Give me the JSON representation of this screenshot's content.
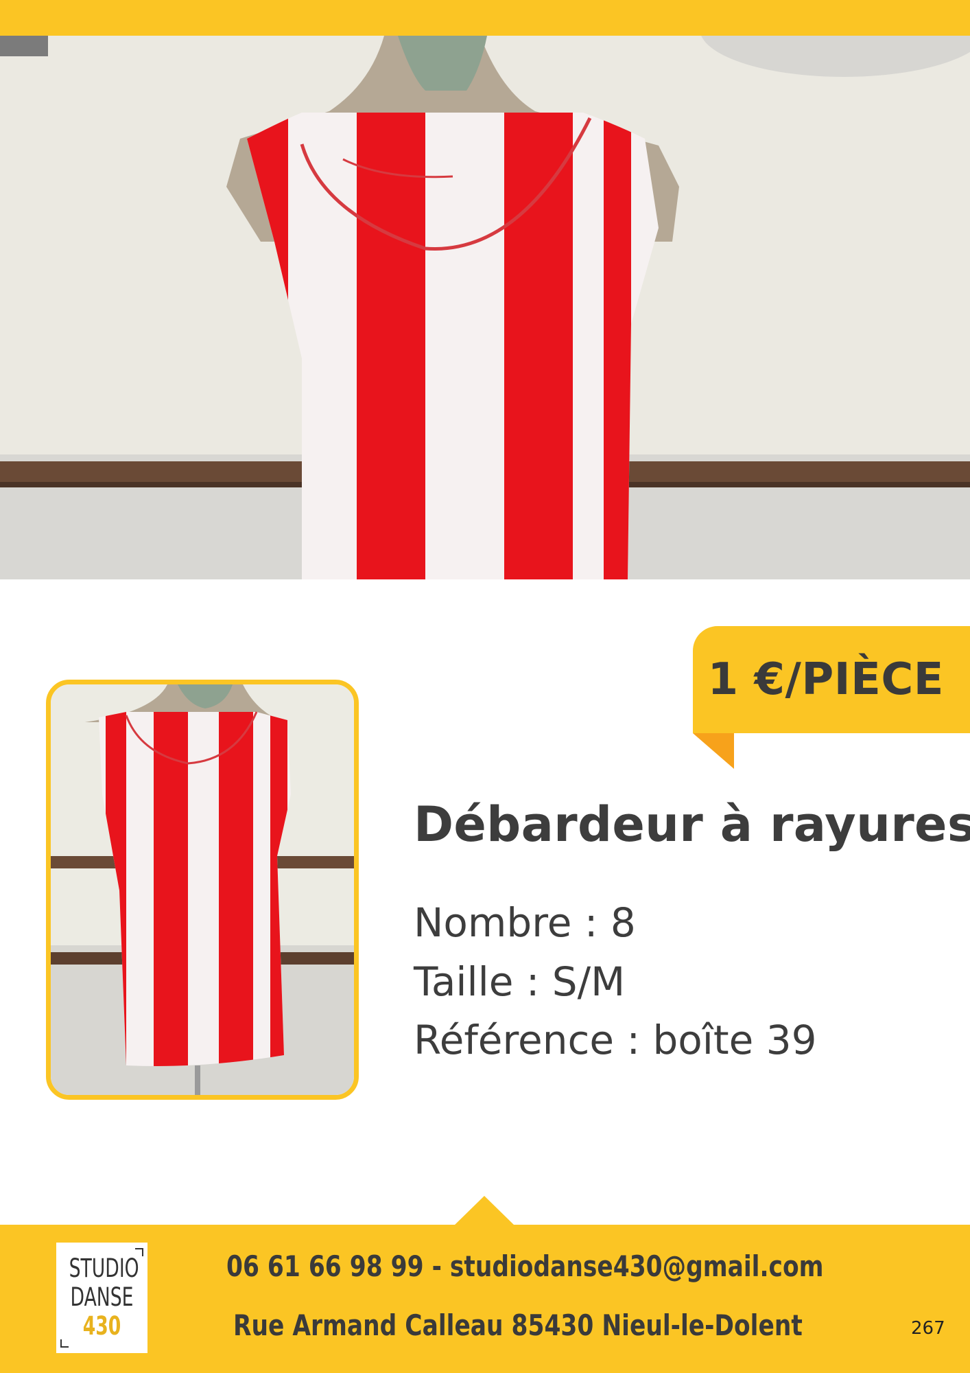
{
  "price": {
    "label": "1 €/PIÈCE"
  },
  "product": {
    "title": "Débardeur à rayures",
    "details": [
      "Nombre : 8",
      "Taille : S/M",
      "Référence : boîte 39"
    ]
  },
  "footer": {
    "logo_lines": [
      "STUDIO",
      "DANSE",
      "430"
    ],
    "contact": "06 61 66 98 99 - studiodanse430@gmail.com",
    "address": "Rue Armand Calleau 85430 Nieul-le-Dolent",
    "page_number": "267"
  },
  "colors": {
    "accent_yellow": "#fbc524",
    "accent_orange": "#f7a21b",
    "text_dark": "#3d3d3d",
    "stripe_red": "#e8141c",
    "stripe_white": "#f6f1f1"
  }
}
